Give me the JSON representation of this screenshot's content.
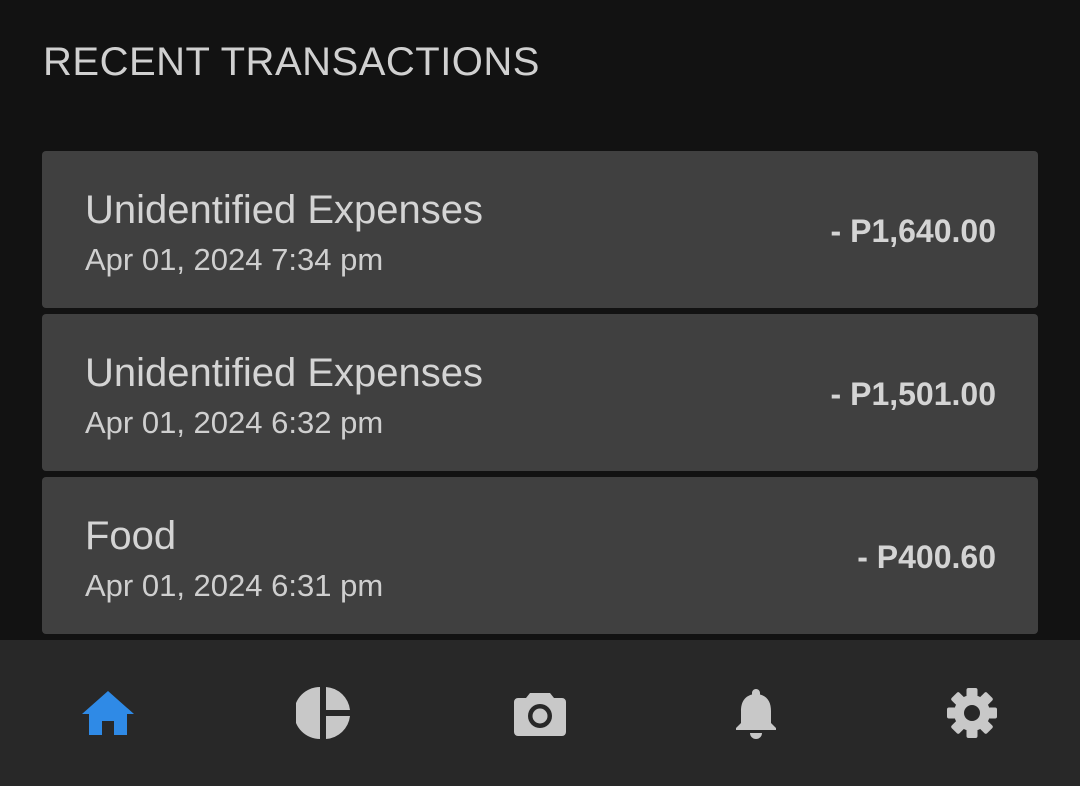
{
  "header": {
    "title": "RECENT TRANSACTIONS"
  },
  "transactions": [
    {
      "category": "Unidentified Expenses",
      "datetime": "Apr 01, 2024 7:34 pm",
      "amount": "- P1,640.00"
    },
    {
      "category": "Unidentified Expenses",
      "datetime": "Apr 01, 2024 6:32 pm",
      "amount": "- P1,501.00"
    },
    {
      "category": "Food",
      "datetime": "Apr 01, 2024 6:31 pm",
      "amount": "- P400.60"
    }
  ],
  "bottom_nav": {
    "items": [
      {
        "icon": "home-icon",
        "active": true
      },
      {
        "icon": "pie-chart-icon",
        "active": false
      },
      {
        "icon": "camera-icon",
        "active": false
      },
      {
        "icon": "bell-icon",
        "active": false
      },
      {
        "icon": "gear-icon",
        "active": false
      }
    ]
  },
  "colors": {
    "background": "#121212",
    "card": "#404040",
    "nav_bar": "#282828",
    "accent": "#2f8ae6",
    "icon_inactive": "#c8c8c8"
  }
}
